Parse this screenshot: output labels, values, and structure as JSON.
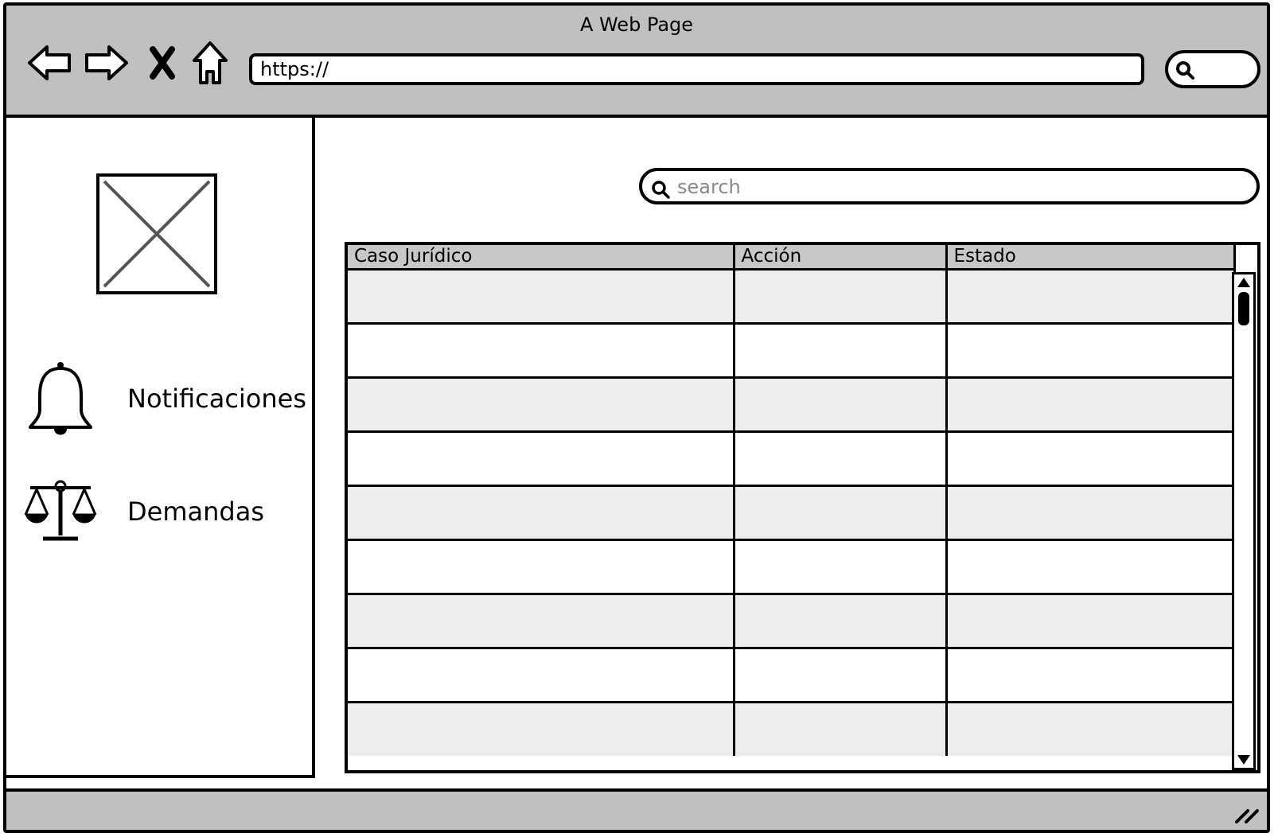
{
  "browser": {
    "title": "A Web Page",
    "url": "https://"
  },
  "sidebar": {
    "items": [
      {
        "label": "Notificaciones",
        "icon": "bell-icon"
      },
      {
        "label": "Demandas",
        "icon": "scales-icon"
      }
    ]
  },
  "search": {
    "placeholder": "search"
  },
  "table": {
    "columns": [
      "Caso Jurídico",
      "Acción",
      "Estado"
    ],
    "rows": [
      [
        "",
        "",
        ""
      ],
      [
        "",
        "",
        ""
      ],
      [
        "",
        "",
        ""
      ],
      [
        "",
        "",
        ""
      ],
      [
        "",
        "",
        ""
      ],
      [
        "",
        "",
        ""
      ],
      [
        "",
        "",
        ""
      ],
      [
        "",
        "",
        ""
      ],
      [
        "",
        "",
        ""
      ]
    ]
  }
}
